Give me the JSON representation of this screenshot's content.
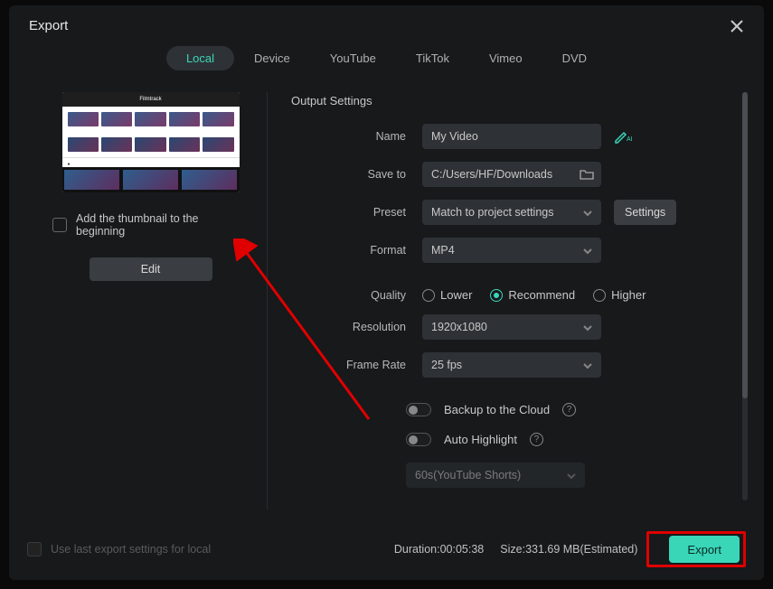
{
  "title": "Export",
  "tabs": [
    "Local",
    "Device",
    "YouTube",
    "TikTok",
    "Vimeo",
    "DVD"
  ],
  "active_tab": 0,
  "left": {
    "thumb_checkbox_label": "Add the thumbnail to the beginning",
    "edit_label": "Edit"
  },
  "settings": {
    "section_title": "Output Settings",
    "name_label": "Name",
    "name_value": "My Video",
    "save_label": "Save to",
    "save_value": "C:/Users/HF/Downloads",
    "preset_label": "Preset",
    "preset_value": "Match to project settings",
    "settings_btn": "Settings",
    "format_label": "Format",
    "format_value": "MP4",
    "quality_label": "Quality",
    "quality_options": [
      "Lower",
      "Recommend",
      "Higher"
    ],
    "quality_selected": 1,
    "resolution_label": "Resolution",
    "resolution_value": "1920x1080",
    "framerate_label": "Frame Rate",
    "framerate_value": "25 fps",
    "backup_label": "Backup to the Cloud",
    "highlight_label": "Auto Highlight",
    "highlight_preset": "60s(YouTube Shorts)"
  },
  "footer": {
    "use_last": "Use last export settings for local",
    "duration_label": "Duration:",
    "duration_value": "00:05:38",
    "size_label": "Size:",
    "size_value": "331.69 MB(Estimated)",
    "export_btn": "Export"
  }
}
